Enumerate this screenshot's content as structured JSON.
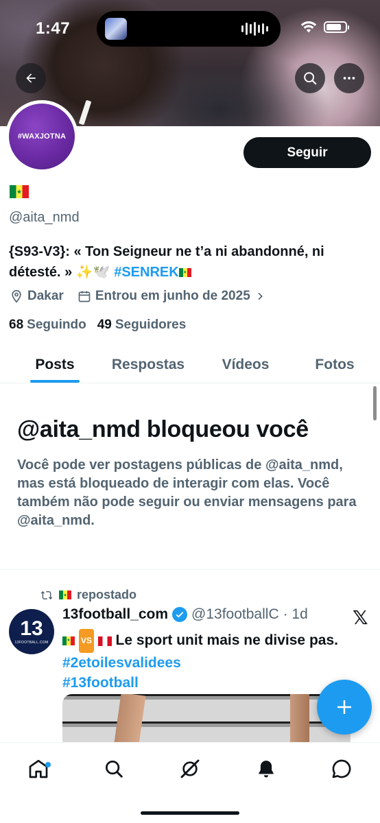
{
  "status_bar": {
    "time": "1:47"
  },
  "profile": {
    "handle": "@aita_nmd",
    "avatar_text": "#WAXJOTNA",
    "bio_text": "{S93-V3}: « Ton Seigneur ne t’a ni abandonné, ni détesté. » ✨🕊️",
    "bio_hashtag": "#SENREK",
    "location": "Dakar",
    "joined": "Entrou em junho de 2025",
    "following_count": "68",
    "following_label": "Seguindo",
    "followers_count": "49",
    "followers_label": "Seguidores",
    "follow_button": "Seguir"
  },
  "tabs": [
    {
      "label": "Posts",
      "active": true
    },
    {
      "label": "Respostas",
      "active": false
    },
    {
      "label": "Vídeos",
      "active": false
    },
    {
      "label": "Fotos",
      "active": false
    }
  ],
  "blocked": {
    "title": "@aita_nmd bloqueou você",
    "description": "Você pode ver postagens públicas de @aita_nmd, mas está bloqueado de interagir com elas. Você também não pode seguir ou enviar mensagens para @aita_nmd."
  },
  "post": {
    "repost_label": "repostado",
    "avatar_text": "13",
    "avatar_subtext": "13FOOTBALL.COM",
    "author_name": "13football_com",
    "author_handle": "@13footballC",
    "time": "· 1d",
    "vs_badge": "VS",
    "text": "Le sport unit mais ne divise pas.",
    "hashtags": [
      "#2etoilesvalidees",
      "#13football"
    ],
    "source_logo": "𝕏"
  },
  "icons": {
    "back": "arrow-left-icon",
    "search": "search-icon",
    "more": "more-horizontal-icon",
    "location": "location-pin-icon",
    "calendar": "calendar-icon",
    "chevron": "chevron-right-icon",
    "repost": "repost-icon",
    "verified": "verified-badge-icon",
    "compose": "plus-icon",
    "nav": [
      "home-icon",
      "search-icon",
      "grok-icon",
      "notifications-icon",
      "messages-icon"
    ]
  },
  "colors": {
    "accent": "#1d9bf0",
    "text_primary": "#0f1419",
    "text_secondary": "#536471",
    "avatar_purple": "#6a2aa3",
    "button_dark": "#0f1419"
  }
}
